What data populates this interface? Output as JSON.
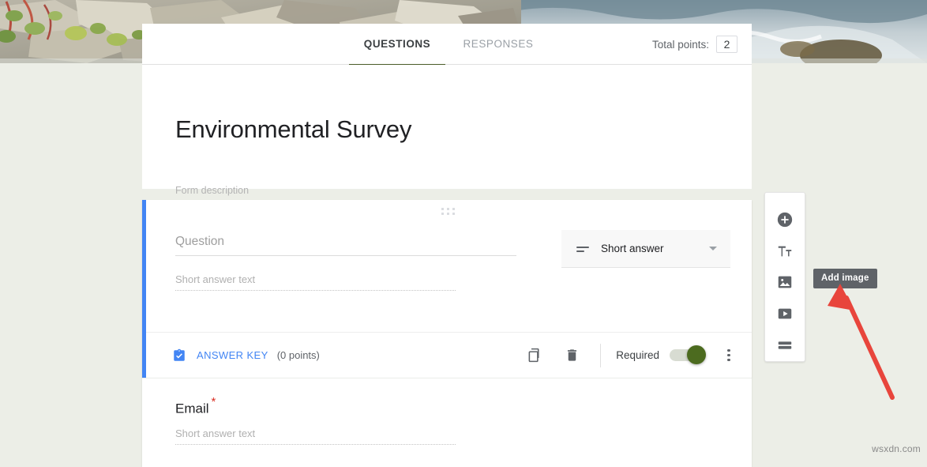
{
  "banner": {
    "alt": "rocky shoreline with water"
  },
  "tabs": {
    "questions": "QUESTIONS",
    "responses": "RESPONSES"
  },
  "total_points": {
    "label": "Total points:",
    "value": "2"
  },
  "form": {
    "title": "Environmental Survey",
    "description_placeholder": "Form description"
  },
  "question": {
    "title_placeholder": "Question",
    "answer_placeholder": "Short answer text",
    "type_label": "Short answer",
    "answer_key_label": "ANSWER KEY",
    "answer_key_points": "(0 points)",
    "required_label": "Required",
    "required_on": true
  },
  "email_item": {
    "title": "Email",
    "required_mark": "*",
    "answer_placeholder": "Short answer text"
  },
  "side_toolbar": {
    "items": [
      {
        "name": "add-question",
        "icon": "plus-circle-icon"
      },
      {
        "name": "add-title",
        "icon": "title-text-icon"
      },
      {
        "name": "add-image",
        "icon": "image-icon"
      },
      {
        "name": "add-video",
        "icon": "video-icon"
      },
      {
        "name": "add-section",
        "icon": "section-icon"
      }
    ]
  },
  "tooltip": {
    "text": "Add image"
  },
  "annotation": {
    "arrow_color": "#e8453c"
  },
  "watermark": {
    "text": "wsxdn.com"
  },
  "colors": {
    "accent_blue": "#4285f4",
    "tab_underline": "#4b5d2a",
    "toggle_on": "#4c6b1f",
    "required_asterisk": "#d93025",
    "page_bg": "#eceee7"
  }
}
